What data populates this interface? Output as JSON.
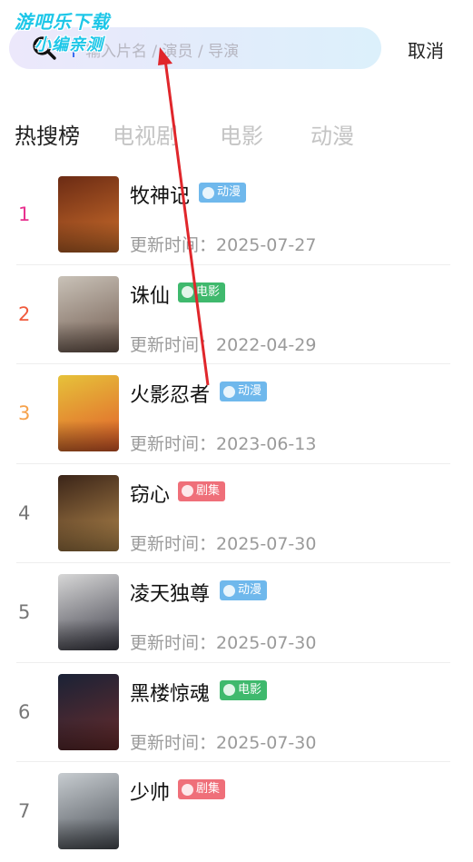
{
  "watermark": {
    "line1": "游吧乐下载",
    "line2": "小编亲测"
  },
  "search": {
    "placeholder": "输入片名 / 演员 / 导演",
    "cancel_label": "取消"
  },
  "tabs": [
    {
      "label": "热搜榜",
      "active": true
    },
    {
      "label": "电视剧",
      "active": false
    },
    {
      "label": "电影",
      "active": false
    },
    {
      "label": "动漫",
      "active": false
    }
  ],
  "list": {
    "update_prefix": "更新时间：",
    "items": [
      {
        "rank": "1",
        "rank_color": "#e8318f",
        "title": "牧神记",
        "tag": "动漫",
        "tag_color": "#6fb8ec",
        "date": "2025-07-27",
        "poster_colors": [
          "#6b2b14",
          "#d0702c"
        ]
      },
      {
        "rank": "2",
        "rank_color": "#f05a3c",
        "title": "诛仙",
        "tag": "电影",
        "tag_color": "#3fb96d",
        "date": "2022-04-29",
        "poster_colors": [
          "#c9c2b8",
          "#705a4e"
        ]
      },
      {
        "rank": "3",
        "rank_color": "#f6a14a",
        "title": "火影忍者",
        "tag": "动漫",
        "tag_color": "#6fb8ec",
        "date": "2023-06-13",
        "poster_colors": [
          "#e6c23a",
          "#e15b2a"
        ]
      },
      {
        "rank": "4",
        "rank_color": "#777777",
        "title": "窃心",
        "tag": "剧集",
        "tag_color": "#ef6f79",
        "date": "2025-07-30",
        "poster_colors": [
          "#3a2418",
          "#b78b4e"
        ]
      },
      {
        "rank": "5",
        "rank_color": "#777777",
        "title": "凌天独尊",
        "tag": "动漫",
        "tag_color": "#6fb8ec",
        "date": "2025-07-30",
        "poster_colors": [
          "#d7d7d7",
          "#3f3f4a"
        ]
      },
      {
        "rank": "6",
        "rank_color": "#777777",
        "title": "黑楼惊魂",
        "tag": "电影",
        "tag_color": "#3fb96d",
        "date": "2025-07-30",
        "poster_colors": [
          "#1a2236",
          "#6a2c2c"
        ]
      },
      {
        "rank": "7",
        "rank_color": "#777777",
        "title": "少帅",
        "tag": "剧集",
        "tag_color": "#ef6f79",
        "date": "",
        "poster_colors": [
          "#c7ccd0",
          "#4a4f56"
        ]
      }
    ]
  }
}
